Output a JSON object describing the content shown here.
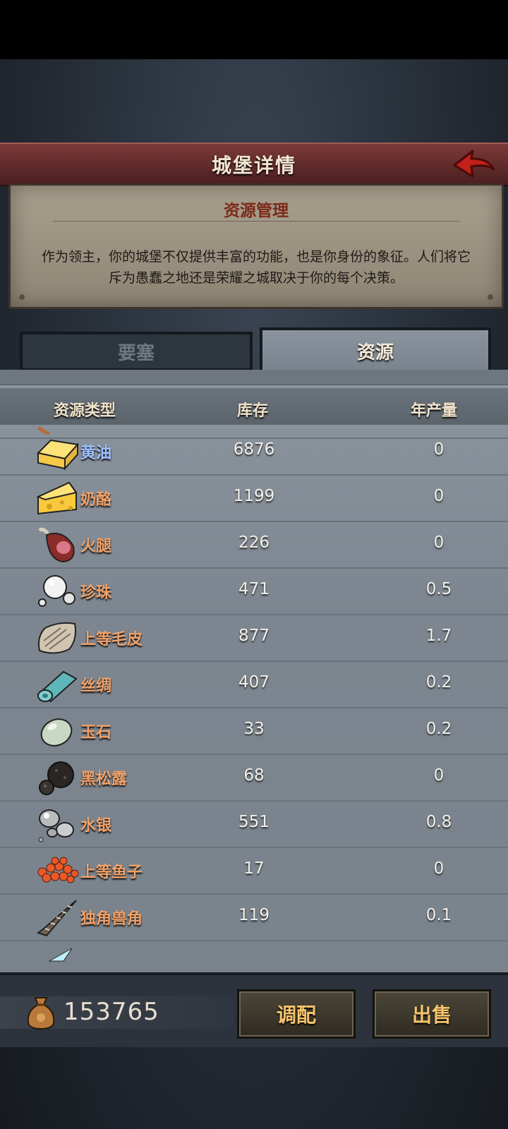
{
  "header": {
    "title": "城堡详情"
  },
  "info": {
    "title": "资源管理",
    "description": "作为领主，你的城堡不仅提供丰富的功能，也是你身份的象征。人们将它斥为愚蠢之地还是荣耀之城取决于你的每个决策。"
  },
  "tabs": [
    {
      "label": "要塞",
      "active": false
    },
    {
      "label": "资源",
      "active": true
    }
  ],
  "table": {
    "columns": [
      "资源类型",
      "库存",
      "年产量"
    ],
    "rows": [
      {
        "name": "黄油",
        "stock": "6876",
        "yield": "0",
        "icon": "butter-icon"
      },
      {
        "name": "奶酪",
        "stock": "1199",
        "yield": "0",
        "icon": "cheese-icon"
      },
      {
        "name": "火腿",
        "stock": "226",
        "yield": "0",
        "icon": "ham-icon"
      },
      {
        "name": "珍珠",
        "stock": "471",
        "yield": "0.5",
        "icon": "pearl-icon"
      },
      {
        "name": "上等毛皮",
        "stock": "877",
        "yield": "1.7",
        "icon": "fur-icon"
      },
      {
        "name": "丝绸",
        "stock": "407",
        "yield": "0.2",
        "icon": "silk-icon"
      },
      {
        "name": "玉石",
        "stock": "33",
        "yield": "0.2",
        "icon": "jade-icon"
      },
      {
        "name": "黑松露",
        "stock": "68",
        "yield": "0",
        "icon": "truffle-icon"
      },
      {
        "name": "水银",
        "stock": "551",
        "yield": "0.8",
        "icon": "mercury-icon"
      },
      {
        "name": "上等鱼子",
        "stock": "17",
        "yield": "0",
        "icon": "caviar-icon"
      },
      {
        "name": "独角兽角",
        "stock": "119",
        "yield": "0.1",
        "icon": "unicorn-horn-icon"
      }
    ]
  },
  "footer": {
    "gold": "153765",
    "gold_icon": "gold-sack-icon",
    "allocate_label": "调配",
    "sell_label": "出售"
  },
  "colors": {
    "name_orange": "#f0a26a",
    "name_blue": "#9fc0ff",
    "title_bar": "#6a2e2d",
    "button_text": "#f6c46a"
  }
}
